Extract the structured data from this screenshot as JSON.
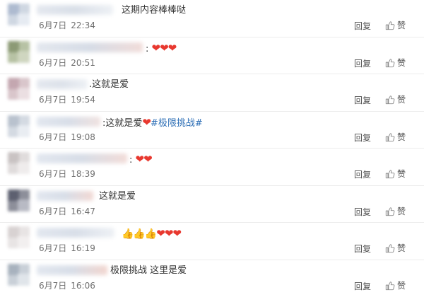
{
  "comments": [
    {
      "content": "这期内容棒棒哒",
      "date": "6月7日",
      "time": "22:34",
      "reply": "回复",
      "like": "赞"
    },
    {
      "content": ":",
      "hearts": "❤❤❤",
      "date": "6月7日",
      "time": "20:51",
      "reply": "回复",
      "like": "赞"
    },
    {
      "content": ".这就是爱",
      "date": "6月7日",
      "time": "19:54",
      "reply": "回复",
      "like": "赞"
    },
    {
      "content": ":这就是爱",
      "hearts": "❤",
      "topic": "#极限挑战#",
      "date": "6月7日",
      "time": "19:08",
      "reply": "回复",
      "like": "赞"
    },
    {
      "content": ":",
      "hearts": "❤❤",
      "date": "6月7日",
      "time": "18:39",
      "reply": "回复",
      "like": "赞"
    },
    {
      "content": "这就是爱",
      "date": "6月7日",
      "time": "16:47",
      "reply": "回复",
      "like": "赞"
    },
    {
      "thumbs": "👍👍👍",
      "hearts": "❤❤❤",
      "date": "6月7日",
      "time": "16:19",
      "reply": "回复",
      "like": "赞"
    },
    {
      "content": "极限挑战 这里是爱",
      "date": "6月7日",
      "time": "16:06",
      "reply": "回复",
      "like": "赞"
    }
  ],
  "colors": {
    "text": "#333333",
    "meta": "#707070",
    "heart": "#e8382f",
    "topic_link": "#2e6fb6",
    "divider": "#ececec"
  },
  "icons": {
    "like": "thumbs-up-icon",
    "heart": "heart-icon",
    "avatar": "blurred-avatar"
  }
}
